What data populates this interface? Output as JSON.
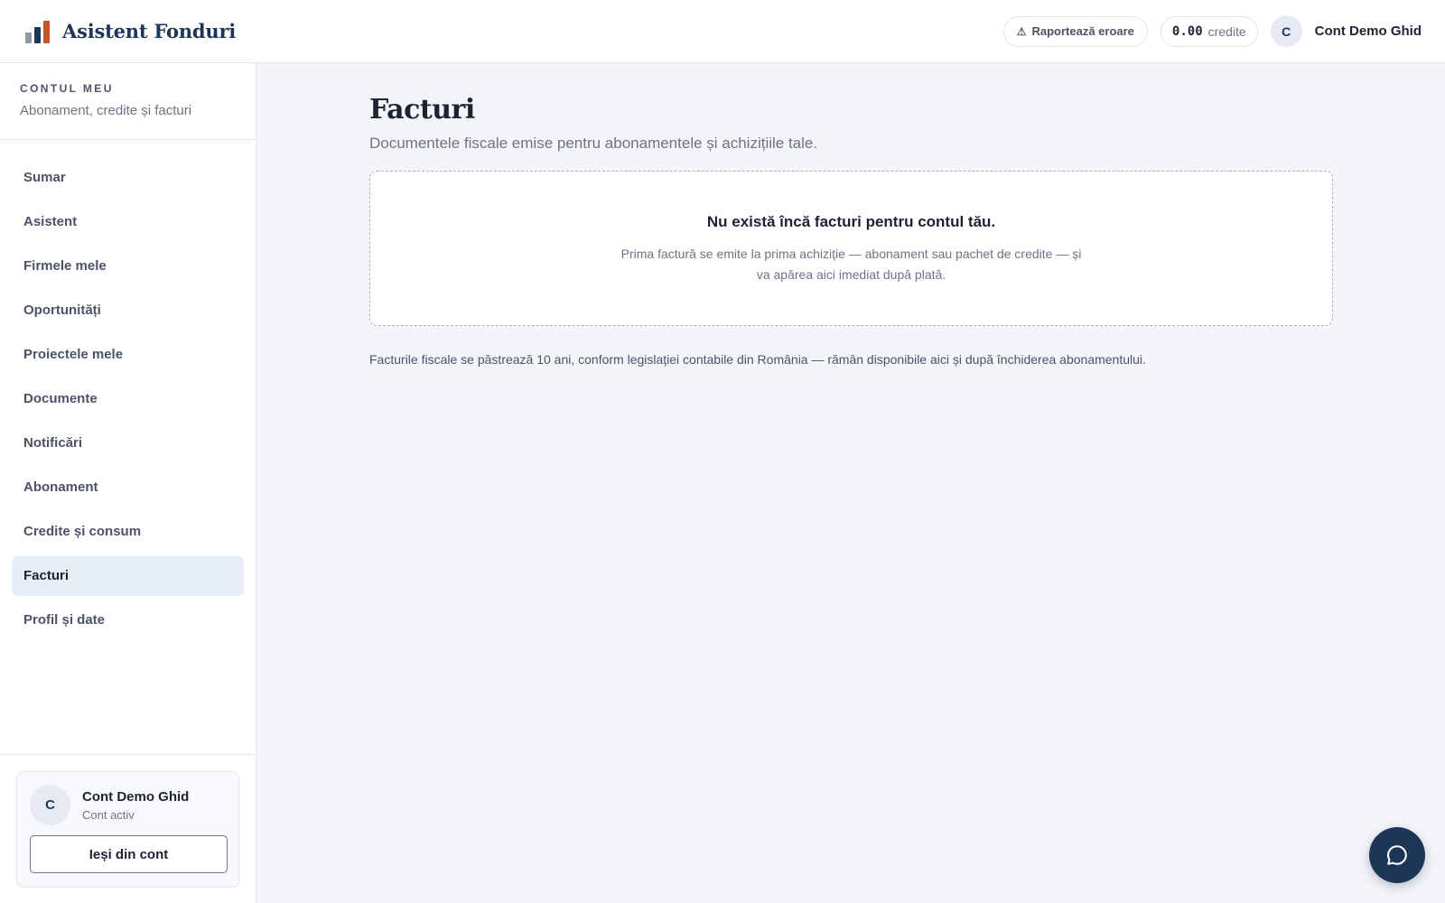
{
  "header": {
    "brand_name": "Asistent Fonduri",
    "report_label": "Raportează eroare",
    "credits_amount": "0.00",
    "credits_unit": "credite",
    "avatar_initial": "C",
    "user_name": "Cont Demo Ghid"
  },
  "sidebar": {
    "eyebrow": "CONTUL MEU",
    "subtitle": "Abonament, credite și facturi",
    "items": [
      {
        "label": "Sumar"
      },
      {
        "label": "Asistent"
      },
      {
        "label": "Firmele mele"
      },
      {
        "label": "Oportunități"
      },
      {
        "label": "Proiectele mele"
      },
      {
        "label": "Documente"
      },
      {
        "label": "Notificări"
      },
      {
        "label": "Abonament"
      },
      {
        "label": "Credite și consum"
      },
      {
        "label": "Facturi",
        "active": true
      },
      {
        "label": "Profil și date"
      }
    ],
    "user": {
      "initial": "C",
      "name": "Cont Demo Ghid",
      "status": "Cont activ",
      "logout_label": "Ieși din cont"
    }
  },
  "main": {
    "title": "Facturi",
    "subtitle": "Documentele fiscale emise pentru abonamentele și achizițiile tale.",
    "empty_title": "Nu există încă facturi pentru contul tău.",
    "empty_text": "Prima factură se emite la prima achiziție — abonament sau pachet de credite — și va apărea aici imediat după plată.",
    "legal_note": "Facturile fiscale se păstrează 10 ani, conform legislației contabile din România — rămân disponibile aici și după închiderea abonamentului."
  },
  "colors": {
    "brand": "#1f3558",
    "accent": "#c4542c",
    "active_nav_bg": "#e8eef6",
    "page_bg": "#f3f5f9"
  },
  "icons": {
    "logo": "bar-chart-logo-icon",
    "report": "warning-icon",
    "chat": "chat-bubble-icon"
  }
}
